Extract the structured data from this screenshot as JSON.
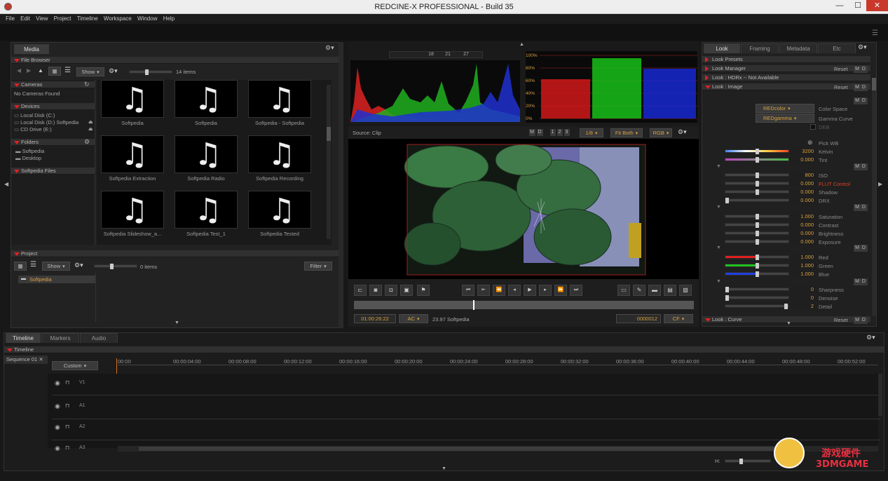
{
  "window": {
    "title": "REDCINE-X PROFESSIONAL - Build 35",
    "min": "—",
    "max": "☐",
    "close": "✕"
  },
  "menu": [
    "File",
    "Edit",
    "View",
    "Project",
    "Timeline",
    "Workspace",
    "Window",
    "Help"
  ],
  "media": {
    "tab": "Media",
    "file_browser": "File Browser",
    "show": "Show",
    "items_count": "14 items",
    "cameras": "Cameras",
    "no_cameras": "No Cameras Found",
    "devices": "Devices",
    "device_list": [
      "Local Disk (C:)",
      "Local Disk (D:) Softpedia",
      "CD Drive (E:)"
    ],
    "folders": "Folders",
    "folder_list": [
      "Softpedia",
      "Desktop"
    ],
    "softpedia_files": "Softpedia Files",
    "thumbs": [
      "Softpedia",
      "Softpedia",
      "Softpedia - Softpedia",
      "Softpedia Extraction",
      "Softpedia Radio",
      "Softpedia Recording",
      "Softpedia Slideshow_a...",
      "Softpedia Test_1",
      "Softpedia Tested"
    ]
  },
  "project": {
    "title": "Project",
    "show": "Show",
    "items": "0 items",
    "filter": "Filter",
    "folder": "Softpedia"
  },
  "scopes": {
    "ticks": [
      "18",
      "21",
      "27"
    ],
    "parade_labels": [
      "100%",
      "80%",
      "60%",
      "40%",
      "20%",
      "0%"
    ]
  },
  "viewer": {
    "source": "Source: Clip",
    "m": "M",
    "d": "D",
    "nums": [
      "1",
      "2",
      "3"
    ],
    "ratio": "1/8",
    "fit": "Fit Both",
    "rgb": "RGB",
    "timecode": "01:00:26:22",
    "ac": "AC",
    "fps": "23.97 Softpedia",
    "frame": "0000012",
    "cf": "CF",
    "play_progress": 0.35
  },
  "look": {
    "tabs": [
      "Look",
      "Framing",
      "Metadata",
      "Etc"
    ],
    "presets": "Look Presets",
    "manager": "Look Manager",
    "hdrx": "Look : HDRx -- Not Available",
    "image": "Look : Image",
    "curve": "Look : Curve",
    "reset": "Reset",
    "md": "M D",
    "color_space": {
      "value": "REDcolor",
      "label": "Color Space"
    },
    "gamma": {
      "value": "REDgamma",
      "label": "Gamma Curve"
    },
    "deb": "DEB",
    "pick_wb": "Pick WB",
    "rows": [
      {
        "label": "Kelvin",
        "value": "3200",
        "pos": 0.5
      },
      {
        "label": "Tint",
        "value": "0.000",
        "pos": 0.5
      },
      {
        "label": "ISO",
        "value": "800",
        "pos": 0.5
      },
      {
        "label": "FLUT Control",
        "value": "0.000",
        "pos": 0.5
      },
      {
        "label": "Shadow",
        "value": "0.000",
        "pos": 0.5
      },
      {
        "label": "DRX",
        "value": "0.000",
        "pos": 0.0
      },
      {
        "label": "Saturation",
        "value": "1.000",
        "pos": 0.5
      },
      {
        "label": "Contrast",
        "value": "0.000",
        "pos": 0.5
      },
      {
        "label": "Brightness",
        "value": "0.000",
        "pos": 0.5
      },
      {
        "label": "Exposure",
        "value": "0.000",
        "pos": 0.5
      },
      {
        "label": "Red",
        "value": "1.000",
        "pos": 0.5
      },
      {
        "label": "Green",
        "value": "1.000",
        "pos": 0.5
      },
      {
        "label": "Blue",
        "value": "1.000",
        "pos": 0.5
      },
      {
        "label": "Sharpness",
        "value": "0",
        "pos": 0.0
      },
      {
        "label": "Denoise",
        "value": "0",
        "pos": 0.0
      },
      {
        "label": "Detail",
        "value": "2",
        "pos": 0.98
      }
    ]
  },
  "timeline": {
    "tabs": [
      "Timeline",
      "Markers",
      "Audio"
    ],
    "title": "Timeline",
    "sequence": "Sequence 01",
    "custom": "Custom",
    "ruler": [
      "00:00",
      "00:00:04:00",
      "00:00:08:00",
      "00:00:12:00",
      "00:00:16:00",
      "00:00:20:00",
      "00:00:24:00",
      "00:00:28:00",
      "00:00:32:00",
      "00:00:36:00",
      "00:00:40:00",
      "00:00:44:00",
      "00:00:48:00",
      "00:00:52:00"
    ],
    "tracks": [
      "V1",
      "A1",
      "A2",
      "A3"
    ],
    "h": "H:"
  },
  "watermark": {
    "cn": "游戏硬件",
    "brand": "3DMGAME"
  }
}
